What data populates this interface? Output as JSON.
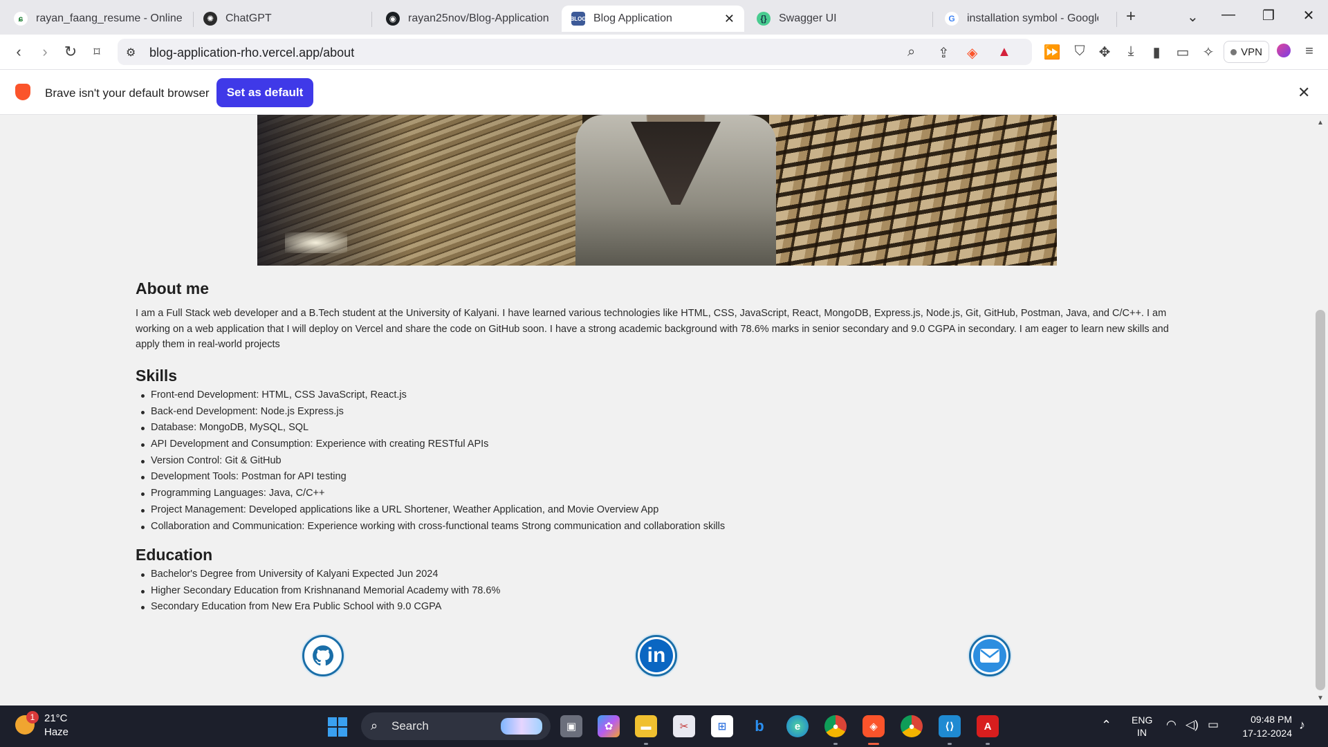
{
  "tabs": [
    {
      "title": "rayan_faang_resume - Online L",
      "icon": "overleaf-icon",
      "active": false
    },
    {
      "title": "ChatGPT",
      "icon": "chatgpt-icon",
      "active": false
    },
    {
      "title": "rayan25nov/Blog-Application",
      "icon": "github-icon",
      "active": false
    },
    {
      "title": "Blog Application",
      "icon": "blog-icon",
      "active": true
    },
    {
      "title": "Swagger UI",
      "icon": "swagger-icon",
      "active": false
    },
    {
      "title": "installation symbol - Google Se",
      "icon": "google-icon",
      "active": false
    }
  ],
  "tab_close_glyph": "✕",
  "new_tab_glyph": "+",
  "toolbar": {
    "url": "blog-application-rho.vercel.app/about",
    "vpn_label": "VPN"
  },
  "infobar": {
    "message": "Brave isn't your default browser",
    "button": "Set as default"
  },
  "about": {
    "heading": "About me",
    "text": "I am a Full Stack web developer and a B.Tech student at the University of Kalyani. I have learned various technologies like HTML, CSS, JavaScript, React, MongoDB, Express.js, Node.js, Git, GitHub, Postman, Java, and C/C++. I am working on a web application that I will deploy on Vercel and share the code on GitHub soon. I have a strong academic background with 78.6% marks in senior secondary and 9.0 CGPA in secondary. I am eager to learn new skills and apply them in real-world projects"
  },
  "skills": {
    "heading": "Skills",
    "items": [
      "Front-end Development: HTML, CSS JavaScript, React.js",
      "Back-end Development: Node.js Express.js",
      "Database: MongoDB, MySQL, SQL",
      "API Development and Consumption: Experience with creating RESTful APIs",
      "Version Control: Git & GitHub",
      "Development Tools: Postman for API testing",
      "Programming Languages: Java, C/C++",
      "Project Management: Developed applications like a URL Shortener, Weather Application, and Movie Overview App",
      "Collaboration and Communication: Experience working with cross-functional teams Strong communication and collaboration skills"
    ]
  },
  "education": {
    "heading": "Education",
    "items": [
      "Bachelor's Degree from University of Kalyani Expected Jun 2024",
      "Higher Secondary Education from Krishnanand Memorial Academy with 78.6%",
      "Secondary Education from New Era Public School with 9.0 CGPA"
    ]
  },
  "social": [
    {
      "name": "github-link",
      "icon": "github-icon"
    },
    {
      "name": "linkedin-link",
      "icon": "linkedin-icon",
      "glyph": "in"
    },
    {
      "name": "email-link",
      "icon": "mail-icon"
    }
  ],
  "taskbar": {
    "weather_badge": "1",
    "temperature": "21°C",
    "condition": "Haze",
    "search_label": "Search",
    "language_line1": "ENG",
    "language_line2": "IN",
    "time": "09:48 PM",
    "date": "17-12-2024"
  },
  "colors": {
    "accent_button": "#3f39e8",
    "brave_orange": "#fb542b",
    "social_ring": "#1a6ea8",
    "page_bg": "#f1f1f1",
    "taskbar_bg": "#1c1f2b"
  }
}
